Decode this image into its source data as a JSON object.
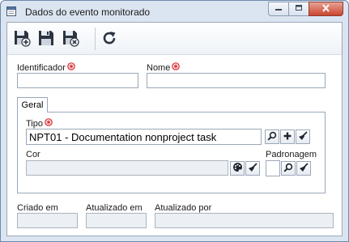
{
  "window": {
    "title": "Dados do evento monitorado",
    "icons": [
      "app-form-icon",
      "minimize-icon",
      "maximize-icon",
      "close-icon"
    ]
  },
  "toolbar": {
    "buttons": [
      {
        "name": "save-new-button",
        "icon": "save-plus-icon"
      },
      {
        "name": "save-button",
        "icon": "save-icon"
      },
      {
        "name": "save-close-button",
        "icon": "save-close-icon"
      },
      {
        "name": "refresh-button",
        "icon": "refresh-icon"
      }
    ]
  },
  "form": {
    "identificador_label": "Identificador",
    "identificador_value": "",
    "nome_label": "Nome",
    "nome_value": ""
  },
  "tabs": [
    {
      "label": "Geral",
      "active": true
    }
  ],
  "geral": {
    "tipo_label": "Tipo",
    "tipo_value": "NPT01 - Documentation nonproject task",
    "cor_label": "Cor",
    "cor_value": "",
    "padronagem_label": "Padronagem",
    "padronagem_value": ""
  },
  "footer": {
    "criado_em_label": "Criado em",
    "criado_em_value": "",
    "atualizado_em_label": "Atualizado em",
    "atualizado_em_value": "",
    "atualizado_por_label": "Atualizado por",
    "atualizado_por_value": ""
  },
  "colors": {
    "required_marker": "#d8262b",
    "window_frame": "#dbe5f1",
    "input_border": "#9aa8b9",
    "readonly_fill": "#eceff3"
  }
}
